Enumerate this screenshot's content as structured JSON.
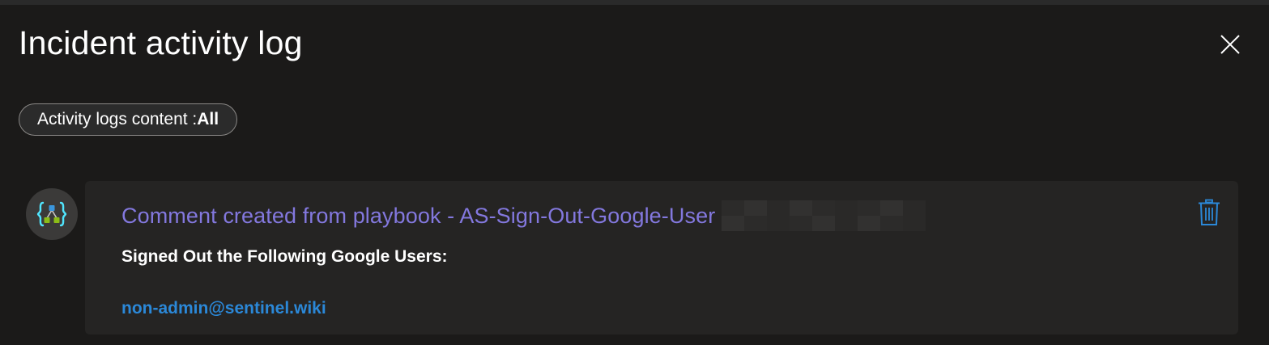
{
  "panel": {
    "title": "Incident activity log",
    "close_icon": "close-icon"
  },
  "filter": {
    "label": "Activity logs content : ",
    "value": "All"
  },
  "entries": [
    {
      "avatar_icon": "logic-app-playbook-icon",
      "title": "Comment created from playbook - AS-Sign-Out-Google-User",
      "body_heading": "Signed Out the Following Google Users:",
      "link_text": "non-admin@sentinel.wiki",
      "delete_icon": "trash-icon",
      "colors": {
        "title": "#8378de",
        "link": "#2b88d8",
        "delete": "#2b88d8"
      }
    }
  ],
  "colors": {
    "background": "#1b1a19",
    "card": "#252423",
    "text": "#ffffff"
  }
}
